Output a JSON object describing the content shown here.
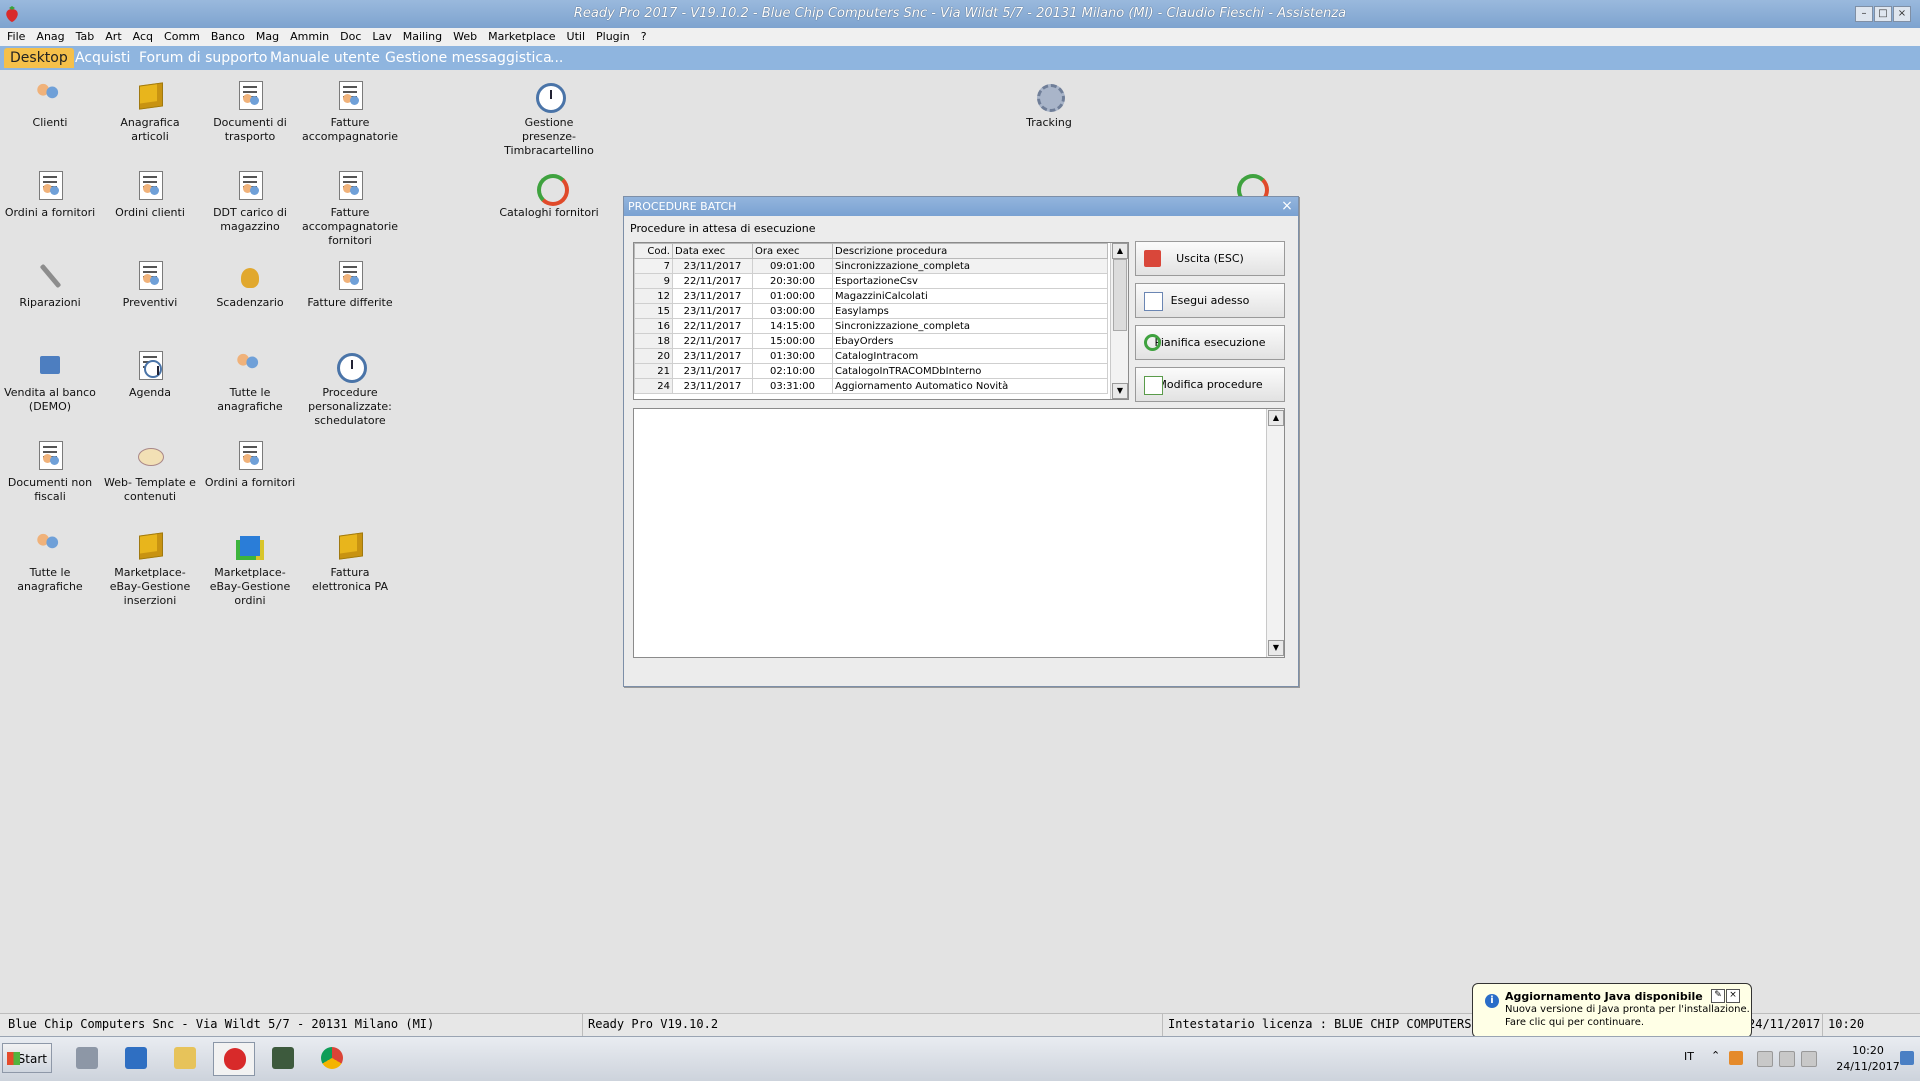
{
  "window": {
    "title": "Ready Pro 2017 - V19.10.2 - Blue Chip Computers Snc - Via Wildt 5/7 - 20131 Milano (MI) - Claudio Fieschi - Assistenza",
    "minimize": "–",
    "maximize": "□",
    "close": "×"
  },
  "menu": [
    "File",
    "Anag",
    "Tab",
    "Art",
    "Acq",
    "Comm",
    "Banco",
    "Mag",
    "Ammin",
    "Doc",
    "Lav",
    "Mailing",
    "Web",
    "Marketplace",
    "Util",
    "Plugin",
    "?"
  ],
  "tabs": [
    "Desktop",
    "Acquisti",
    "Forum di supporto",
    "Manuale utente",
    "Gestione messaggistica",
    "..."
  ],
  "desktop_icons": [
    {
      "label": "Clienti",
      "icon": "customers-icon"
    },
    {
      "label": "Anagrafica articoli",
      "icon": "articles-box-icon"
    },
    {
      "label": "Documenti di trasporto",
      "icon": "document-people-icon"
    },
    {
      "label": "Fatture accompagnatorie",
      "icon": "document-people-icon"
    },
    {
      "label": "Gestione presenze-Timbracartellino",
      "icon": "clock-icon"
    },
    {
      "label": "Tracking",
      "icon": "gear-icon"
    },
    {
      "label": "Ordini a fornitori",
      "icon": "document-people-icon"
    },
    {
      "label": "Ordini clienti",
      "icon": "document-people-icon"
    },
    {
      "label": "DDT carico di magazzino",
      "icon": "document-people-icon"
    },
    {
      "label": "Fatture accompagnatorie fornitori",
      "icon": "document-people-icon"
    },
    {
      "label": "Cataloghi fornitori",
      "icon": "refresh-arrows-icon"
    },
    {
      "label": "Riparazioni",
      "icon": "wrench-icon"
    },
    {
      "label": "Preventivi",
      "icon": "document-people-icon"
    },
    {
      "label": "Scadenzario",
      "icon": "money-bag-icon"
    },
    {
      "label": "Fatture differite",
      "icon": "document-people-icon"
    },
    {
      "label": "Vendita al banco (DEMO)",
      "icon": "cash-register-icon"
    },
    {
      "label": "Agenda",
      "icon": "agenda-icon"
    },
    {
      "label": "Tutte le anagrafiche",
      "icon": "customers-icon"
    },
    {
      "label": "Procedure personalizzate: schedulatore",
      "icon": "clock-icon"
    },
    {
      "label": "Documenti non fiscali",
      "icon": "document-people-icon"
    },
    {
      "label": "Web- Template e contenuti",
      "icon": "paint-palette-icon"
    },
    {
      "label": "Ordini a fornitori",
      "icon": "document-people-icon"
    },
    {
      "label": "Tutte le anagrafiche",
      "icon": "customers-icon"
    },
    {
      "label": "Marketplace- eBay-Gestione inserzioni",
      "icon": "articles-box-icon"
    },
    {
      "label": "Marketplace- eBay-Gestione ordini",
      "icon": "cubes-icon"
    },
    {
      "label": "Fattura elettronica PA",
      "icon": "articles-box-icon"
    }
  ],
  "dialog": {
    "title": "PROCEDURE BATCH",
    "close": "×",
    "subtitle": "Procedure in attesa di esecuzione",
    "columns": [
      "Cod.",
      "Data exec",
      "Ora exec",
      "Descrizione procedura"
    ],
    "rows": [
      [
        "7",
        "23/11/2017",
        "09:01:00",
        "Sincronizzazione_completa"
      ],
      [
        "9",
        "22/11/2017",
        "20:30:00",
        "EsportazioneCsv"
      ],
      [
        "12",
        "23/11/2017",
        "01:00:00",
        "MagazziniCalcolati"
      ],
      [
        "15",
        "23/11/2017",
        "03:00:00",
        "Easylamps"
      ],
      [
        "16",
        "22/11/2017",
        "14:15:00",
        "Sincronizzazione_completa"
      ],
      [
        "18",
        "22/11/2017",
        "15:00:00",
        "EbayOrders"
      ],
      [
        "20",
        "23/11/2017",
        "01:30:00",
        "CatalogIntracom"
      ],
      [
        "21",
        "23/11/2017",
        "02:10:00",
        "CatalogoInTRACOMDbInterno"
      ],
      [
        "24",
        "23/11/2017",
        "03:31:00",
        "Aggiornamento Automatico Novità"
      ]
    ],
    "buttons": {
      "exit": "Uscita (ESC)",
      "run_now": "Esegui adesso",
      "schedule": "Pianifica esecuzione",
      "edit": "Modifica procedure"
    }
  },
  "statusbar": {
    "company": "Blue Chip Computers Snc - Via Wildt 5/7 - 20131 Milano (MI)",
    "version": "Ready Pro V19.10.2",
    "license": "Intestatario licenza : BLUE CHIP COMPUTERS SNC D",
    "date": "24/11/2017",
    "time": "10:20"
  },
  "notification": {
    "title": "Aggiornamento Java disponibile",
    "line1": "Nuova versione di Java pronta per l'installazione.",
    "line2": "Fare clic qui per continuare."
  },
  "taskbar": {
    "start": "Start",
    "lang": "IT",
    "clock_time": "10:20",
    "clock_date": "24/11/2017"
  },
  "colors": {
    "titlebar": "#7ea3cf",
    "tabbar": "#8fb5df",
    "active_tab": "#f5c04a",
    "desktop": "#e3e3e3"
  }
}
